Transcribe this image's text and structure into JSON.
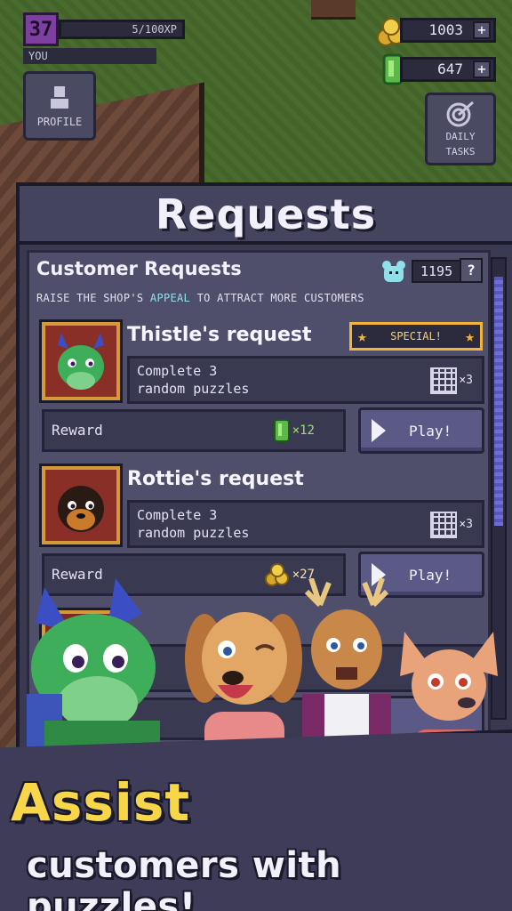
{
  "hud": {
    "level": "37",
    "xp": "5/100XP",
    "player_name": "YOU",
    "profile_label": "PROFILE",
    "coins": "1003",
    "gems": "647",
    "plus": "+",
    "daily_tasks_label_1": "DAILY",
    "daily_tasks_label_2": "TASKS"
  },
  "panel": {
    "title": "Requests",
    "section_title": "Customer Requests",
    "appeal_value": "1195",
    "help": "?",
    "subtitle_pre": "RAISE THE SHOP'S ",
    "subtitle_hl": "APPEAL",
    "subtitle_post": " TO ATTRACT MORE CUSTOMERS"
  },
  "requests": [
    {
      "title": "Thistle's request",
      "special": "SPECIAL!",
      "task_line1": "Complete 3",
      "task_line2": "random puzzles",
      "task_count": "×3",
      "reward_label": "Reward",
      "reward_amount": "×12",
      "reward_type": "gem",
      "play_label": "Play!"
    },
    {
      "title": "Rottie's request",
      "task_line1": "Complete 3",
      "task_line2": "random puzzles",
      "task_count": "×3",
      "reward_label": "Reward",
      "reward_amount": "×27",
      "reward_type": "coin",
      "play_label": "Play!"
    }
  ],
  "banner": {
    "line1": "Assist",
    "line2": "customers with puzzles!"
  },
  "colors": {
    "panel_bg": "#3a3952",
    "accent_yellow": "#f8d64a",
    "special_border": "#f2b53a",
    "appeal_highlight": "#8fe0e8",
    "gem_green": "#98e070"
  }
}
